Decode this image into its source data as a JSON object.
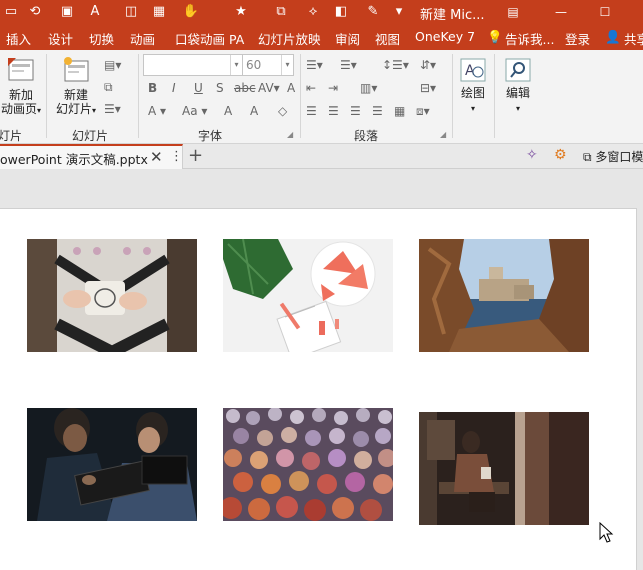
{
  "window": {
    "title": "新建 Mic..."
  },
  "menu": {
    "tabs": [
      "插入",
      "设计",
      "切换",
      "动画",
      "口袋动画 PA",
      "幻灯片放映",
      "审阅",
      "视图",
      "OneKey 7"
    ],
    "tell_me": "告诉我...",
    "login": "登录",
    "share": "共享"
  },
  "ribbon": {
    "new_animation_page": {
      "line1": "新加",
      "line2": "动画页"
    },
    "new_slide": {
      "line1": "新建",
      "line2": "幻灯片"
    },
    "font_size_value": "60",
    "draw_label": "绘图",
    "edit_label": "编辑",
    "groups": {
      "slides_partial": "灯片",
      "slides": "幻灯片",
      "font": "字体",
      "paragraph": "段落"
    }
  },
  "doc_tab": {
    "name": "owerPoint 演示文稿.pptx",
    "multi_window": "多窗口模"
  },
  "slide": {
    "photos": [
      {
        "subject": "sweater-mug"
      },
      {
        "subject": "watermelon-notebook"
      },
      {
        "subject": "castle-rocks"
      },
      {
        "subject": "two-people-tablet"
      },
      {
        "subject": "bokeh-lights"
      },
      {
        "subject": "subway-person"
      }
    ]
  },
  "colors": {
    "accent": "#c43e1c",
    "ribbon": "#f3f3f3",
    "canvas": "#e6e6e6"
  }
}
